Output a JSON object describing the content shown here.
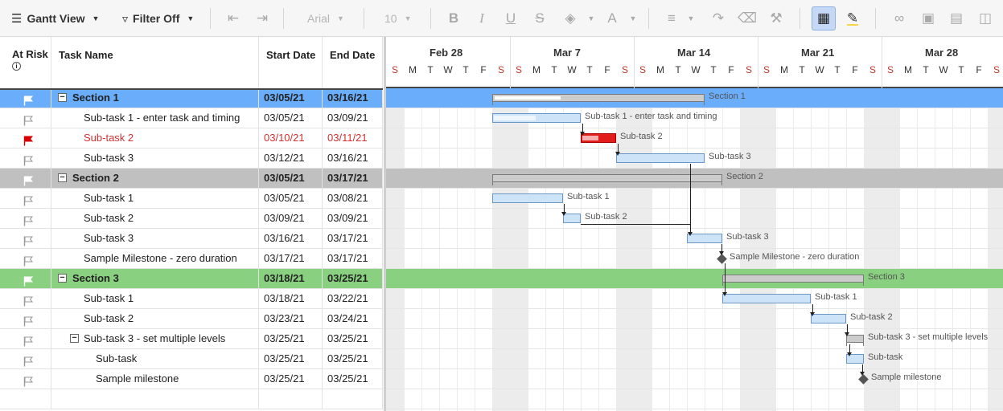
{
  "toolbar": {
    "gantt_view": "Gantt View",
    "filter": "Filter Off",
    "font": "Arial",
    "font_size": "10",
    "highlight_color": "#f7d547"
  },
  "grid": {
    "headers": {
      "at_risk": "At Risk",
      "task_name": "Task Name",
      "start_date": "Start Date",
      "end_date": "End Date"
    },
    "rows": [
      {
        "type": "section",
        "name": "Section 1",
        "start": "03/05/21",
        "end": "03/16/21",
        "color": "#6aaefb",
        "flag": "white"
      },
      {
        "type": "task",
        "name": "Sub-task 1 - enter task and timing",
        "start": "03/05/21",
        "end": "03/09/21",
        "flag": "grey"
      },
      {
        "type": "task",
        "name": "Sub-task 2",
        "start": "03/10/21",
        "end": "03/11/21",
        "flag": "red",
        "at_risk": true
      },
      {
        "type": "task",
        "name": "Sub-task 3",
        "start": "03/12/21",
        "end": "03/16/21",
        "flag": "grey"
      },
      {
        "type": "section",
        "name": "Section 2",
        "start": "03/05/21",
        "end": "03/17/21",
        "color": "#c0c0c0",
        "flag": "white"
      },
      {
        "type": "task",
        "name": "Sub-task 1",
        "start": "03/05/21",
        "end": "03/08/21",
        "flag": "grey"
      },
      {
        "type": "task",
        "name": "Sub-task 2",
        "start": "03/09/21",
        "end": "03/09/21",
        "flag": "grey"
      },
      {
        "type": "task",
        "name": "Sub-task 3",
        "start": "03/16/21",
        "end": "03/17/21",
        "flag": "grey"
      },
      {
        "type": "task",
        "name": "Sample Milestone - zero duration",
        "start": "03/17/21",
        "end": "03/17/21",
        "flag": "grey"
      },
      {
        "type": "section",
        "name": "Section 3",
        "start": "03/18/21",
        "end": "03/25/21",
        "color": "#89d180",
        "flag": "white"
      },
      {
        "type": "task",
        "name": "Sub-task 1",
        "start": "03/18/21",
        "end": "03/22/21",
        "flag": "grey"
      },
      {
        "type": "task",
        "name": "Sub-task 2",
        "start": "03/23/21",
        "end": "03/24/21",
        "flag": "grey"
      },
      {
        "type": "parent",
        "name": "Sub-task 3 - set multiple levels",
        "start": "03/25/21",
        "end": "03/25/21",
        "flag": "grey"
      },
      {
        "type": "subtask",
        "name": "Sub-task",
        "start": "03/25/21",
        "end": "03/25/21",
        "flag": "grey"
      },
      {
        "type": "subtask",
        "name": "Sample milestone",
        "start": "03/25/21",
        "end": "03/25/21",
        "flag": "grey"
      }
    ]
  },
  "gantt": {
    "weeks": [
      "Feb 28",
      "Mar 7",
      "Mar 14",
      "Mar 21",
      "Mar 28"
    ],
    "day_letters": [
      "S",
      "M",
      "T",
      "W",
      "T",
      "F",
      "S"
    ],
    "weekend_color": "#c0392b",
    "labels": [
      "Section 1",
      "Sub-task 1 - enter task and timing",
      "Sub-task 2",
      "Sub-task 3",
      "Section 2",
      "Sub-task 1",
      "Sub-task 2",
      "Sub-task 3",
      "Sample Milestone - zero duration",
      "Section 3",
      "Sub-task 1",
      "Sub-task 2",
      "Sub-task 3 - set multiple levels",
      "Sub-task",
      "Sample milestone"
    ]
  }
}
